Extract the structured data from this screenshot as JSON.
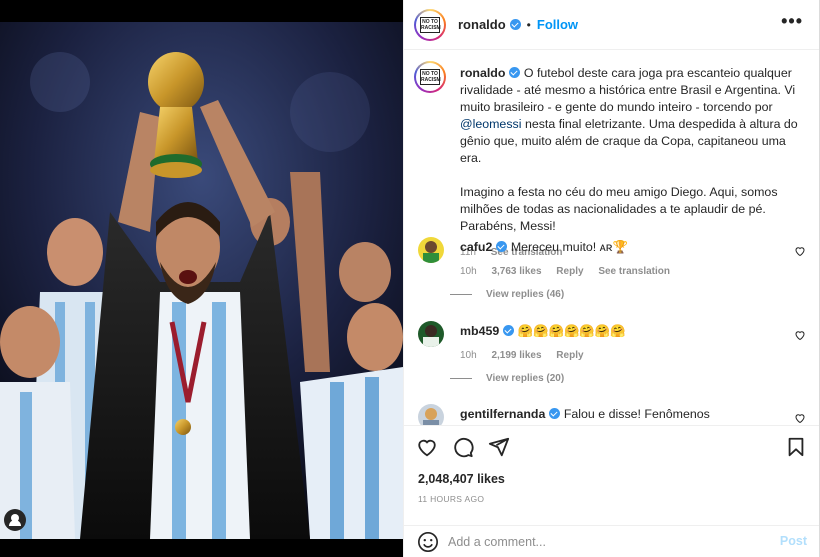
{
  "post": {
    "username": "ronaldo",
    "follow_label": "Follow",
    "dot": "•",
    "more": "•••",
    "avatar_text": "NO TO RACISM"
  },
  "caption": {
    "username": "ronaldo",
    "text": "O futebol deste cara joga pra escanteio qualquer rivalidade - até mesmo a histórica entre Brasil e Argentina. Vi muito brasileiro - e gente do mundo inteiro - torcendo por",
    "mention": "@leomessi",
    "text2": "nesta final eletrizante. Uma despedida à altura do gênio que, muito além de craque da Copa, capitaneou uma era.",
    "text3": "Imagino a festa no céu do meu amigo Diego. Aqui, somos milhões de todas as nacionalidades a te aplaudir de pé. Parabéns, Messi!",
    "time": "11h",
    "see_translation": "See translation"
  },
  "comments": [
    {
      "username": "cafu2",
      "text": "Mereceu muito! ᴀʀ🏆",
      "time": "10h",
      "likes": "3,763 likes",
      "reply": "Reply",
      "see_translation": "See translation",
      "view_replies": "View replies (46)"
    },
    {
      "username": "mb459",
      "text": "🤗🤗🤗🤗🤗🤗🤗",
      "time": "10h",
      "likes": "2,199 likes",
      "reply": "Reply",
      "view_replies": "View replies (20)"
    },
    {
      "username": "gentilfernanda",
      "text": "Falou e disse! Fenômenos reconhecem"
    }
  ],
  "footer": {
    "likes": "2,048,407 likes",
    "ago": "11 HOURS AGO",
    "comment_placeholder": "Add a comment...",
    "post_label": "Post"
  },
  "colors": {
    "accent": "#0095f6",
    "verified": "#3897f0",
    "muted": "#8e8e8e",
    "text": "#262626"
  },
  "icons": [
    "heart-icon",
    "comment-icon",
    "share-icon",
    "bookmark-icon",
    "emoji-icon",
    "verified-icon",
    "more-icon",
    "user-tag-icon"
  ]
}
